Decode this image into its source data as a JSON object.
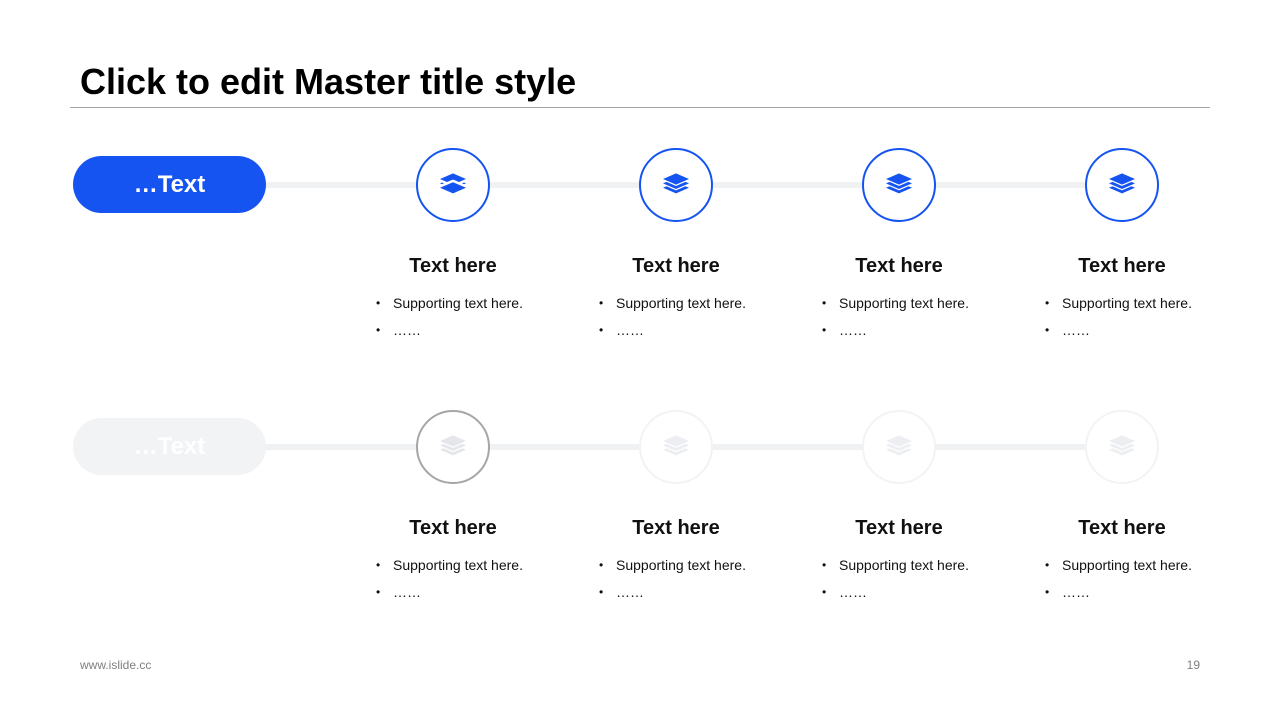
{
  "title": "Click to edit Master title style",
  "colors": {
    "accent": "#1554f0",
    "track": "#f0f1f3",
    "inactive": "#f2f3f5",
    "current_ring": "#a6a6a6",
    "icon_faded": "#eceef1",
    "icon_current": "#e4e6ea"
  },
  "rows": [
    {
      "label": "…Text",
      "state": "active",
      "columns": [
        {
          "icon": "layers-icon",
          "heading": "Text here",
          "bullets": [
            "Supporting text here.",
            "……"
          ]
        },
        {
          "icon": "layers-icon",
          "heading": "Text here",
          "bullets": [
            "Supporting text here.",
            "……"
          ]
        },
        {
          "icon": "layers-icon",
          "heading": "Text here",
          "bullets": [
            "Supporting text here.",
            "……"
          ]
        },
        {
          "icon": "layers-icon",
          "heading": "Text here",
          "bullets": [
            "Supporting text here.",
            "……"
          ]
        }
      ]
    },
    {
      "label": "…Text",
      "state": "inactive",
      "columns": [
        {
          "icon": "layers-icon",
          "heading": "Text here",
          "bullets": [
            "Supporting text here.",
            "……"
          ]
        },
        {
          "icon": "layers-icon",
          "heading": "Text here",
          "bullets": [
            "Supporting text here.",
            "……"
          ]
        },
        {
          "icon": "layers-icon",
          "heading": "Text here",
          "bullets": [
            "Supporting text here.",
            "……"
          ]
        },
        {
          "icon": "layers-icon",
          "heading": "Text here",
          "bullets": [
            "Supporting text here.",
            "……"
          ]
        }
      ]
    }
  ],
  "footer": {
    "website": "www.islide.cc",
    "page_number": "19"
  }
}
